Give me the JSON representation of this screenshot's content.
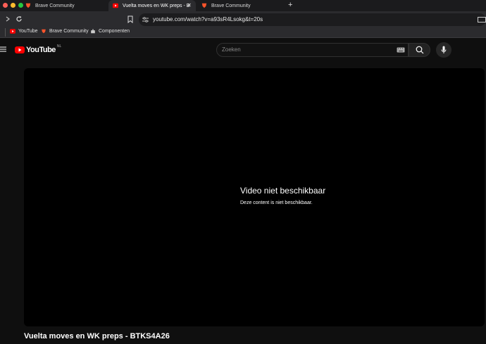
{
  "browser": {
    "tabs": [
      {
        "label": "Brave Community"
      },
      {
        "label": "Vuelta moves en WK preps - B"
      },
      {
        "label": "Brave Community"
      }
    ],
    "address": "youtube.com/watch?v=a93sR4Lsokg&t=20s",
    "bookmarks": [
      {
        "label": "YouTube"
      },
      {
        "label": "Brave Community"
      },
      {
        "label": "Componenten"
      }
    ]
  },
  "youtube": {
    "logo_text": "YouTube",
    "region": "NL",
    "search_placeholder": "Zoeken"
  },
  "player": {
    "error_title": "Video niet beschikbaar",
    "error_subtitle": "Deze content is niet beschikbaar."
  },
  "video": {
    "title": "Vuelta moves en WK preps - BTKS4A26"
  },
  "colors": {
    "youtube_red": "#ff0000",
    "brave_orange": "#fb542b"
  }
}
